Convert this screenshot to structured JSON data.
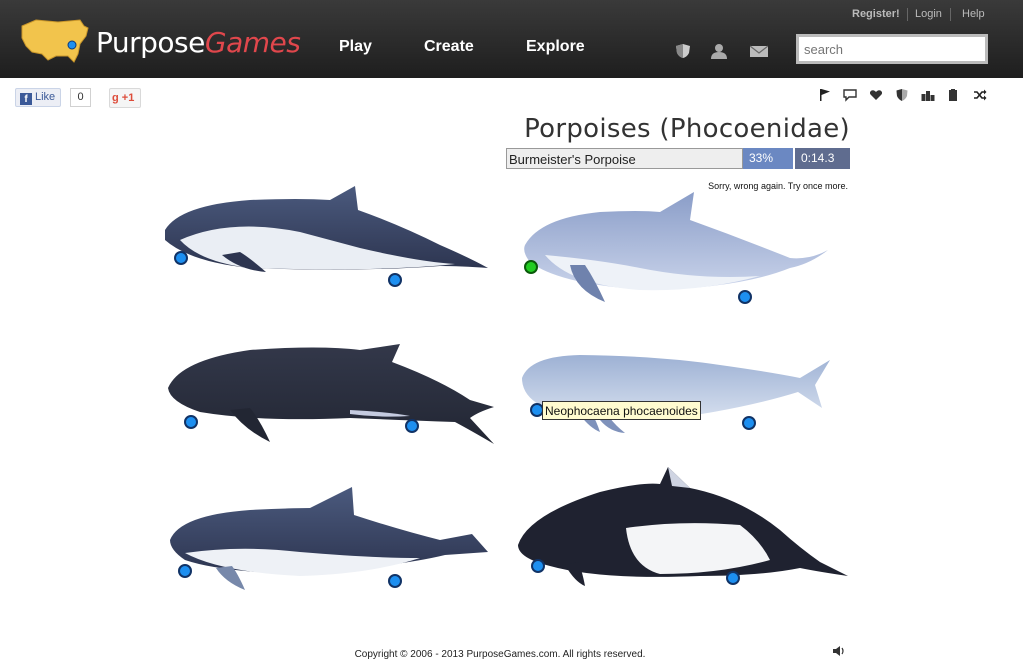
{
  "header": {
    "logo_text_1": "Purpose",
    "logo_text_2": "Games",
    "nav": [
      "Play",
      "Create",
      "Explore"
    ],
    "top_links": [
      "Register!",
      "Login",
      "Help"
    ],
    "search_placeholder": "search",
    "header_icons": [
      "shield-icon",
      "user-icon",
      "mail-icon"
    ]
  },
  "social": {
    "like_label": "Like",
    "like_count": "0",
    "gplus_label": "+1"
  },
  "toolbar_icons": [
    "flag-icon",
    "comment-icon",
    "heart-icon",
    "shield-icon",
    "leaderboard-icon",
    "copy-icon",
    "shuffle-icon"
  ],
  "game": {
    "title": "Porpoises (Phocoenidae)",
    "current_question": "Burmeister's Porpoise",
    "progress_percent": "33%",
    "progress_value": 0.33,
    "timer": "0:14.3",
    "feedback": "Sorry, wrong again. Try once more.",
    "tooltip": "Neophocaena phocaenoides",
    "pins_total": 12,
    "pins_correct": 1
  },
  "footer": {
    "copyright": "Copyright © 2006 - 2013 PurposeGames.com.  All rights reserved."
  },
  "colors": {
    "header_bg": "#2a2a2a",
    "brand_red": "#e0474c",
    "pin_blue": "#1d8ff0",
    "pin_correct": "#22cc22",
    "percent_bg": "#6b88c2",
    "timer_bg": "#5f6c8f"
  }
}
